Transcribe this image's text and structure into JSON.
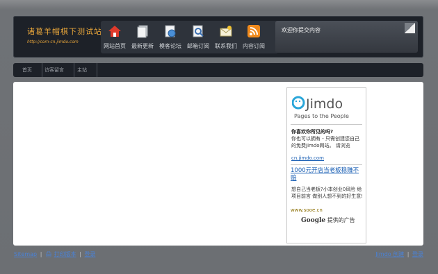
{
  "header": {
    "site_title": "诸葛羊帽棋下测试站",
    "site_url": "http://com-cn.jimdo.com",
    "nav": [
      {
        "label": "网站首页",
        "icon": "home-icon"
      },
      {
        "label": "最新更新",
        "icon": "documents-icon"
      },
      {
        "label": "模客论坛",
        "icon": "globe-document-icon"
      },
      {
        "label": "邮箱订阅",
        "icon": "magnifier-document-icon"
      },
      {
        "label": "联系我们",
        "icon": "envelope-icon"
      },
      {
        "label": "内容订阅",
        "icon": "rss-icon"
      }
    ],
    "notice_text": "欢迎你提交内容"
  },
  "menu": {
    "items": [
      "首页",
      "访客留言",
      "主站"
    ]
  },
  "ad": {
    "brand": "Jimdo",
    "tagline": "Pages to the People",
    "heading": "你喜欢你所见的吗?",
    "body": "你也可以拥有 - 只需创建您自己的免费Jimdo网站。 请浏览",
    "link": "cn.jimdo.com",
    "ad2_title": "1000元开店当老板稳赚不赔",
    "ad2_body": "想自己当老板?小本创业0风险 给项目前言 做别人想不到的好生意!",
    "ad2_url": "www.sooe.cn",
    "google_brand": "Google",
    "google_suffix": "提供的广告"
  },
  "footer": {
    "left_link1": "Sitemap",
    "left_link2": "打印版本",
    "left_link3": "登录",
    "right_link1": "Jimdo 创建",
    "right_link2": "登录"
  },
  "colors": {
    "accent": "#e7a53a",
    "link": "#1a5fb4"
  }
}
